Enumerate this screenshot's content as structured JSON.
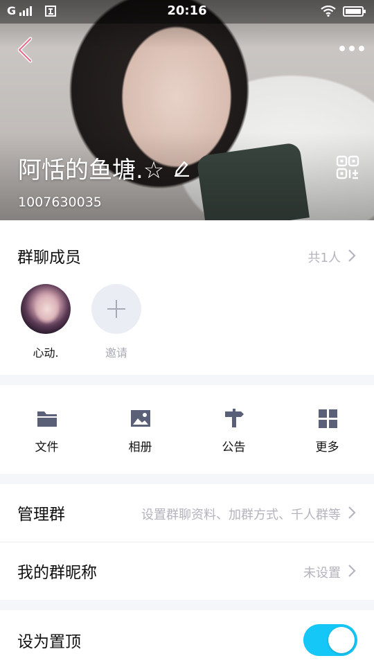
{
  "status_bar": {
    "time": "20:16",
    "signal_label": "G",
    "battery_level": 0.9
  },
  "header": {
    "group_name": "阿恬的鱼塘.☆",
    "group_id": "1007630035"
  },
  "members": {
    "title": "群聊成员",
    "count": "共1人",
    "list": [
      {
        "name": "心动."
      }
    ],
    "invite_label": "邀请"
  },
  "tools": [
    {
      "label": "文件",
      "icon": "folder-icon"
    },
    {
      "label": "相册",
      "icon": "photo-icon"
    },
    {
      "label": "公告",
      "icon": "signpost-icon"
    },
    {
      "label": "更多",
      "icon": "grid-icon"
    }
  ],
  "manage": {
    "title": "管理群",
    "value": "设置群聊资料、加群方式、千人群等"
  },
  "nickname": {
    "title": "我的群昵称",
    "value": "未设置"
  },
  "pin_top": {
    "title": "设为置顶",
    "enabled": true
  },
  "colors": {
    "accent": "#14c7f7",
    "muted_text": "#b3b4bd",
    "background": "#f5f6fa"
  }
}
